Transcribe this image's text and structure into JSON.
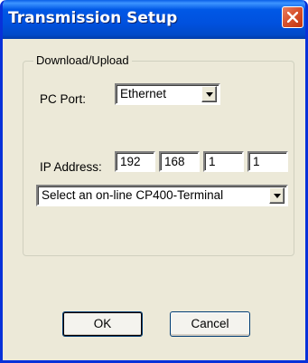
{
  "window": {
    "title": "Transmission Setup",
    "close_icon": "close-icon"
  },
  "group": {
    "legend": "Download/Upload"
  },
  "pc_port": {
    "label": "PC Port:",
    "value": "Ethernet"
  },
  "ip_address": {
    "label": "IP Address:",
    "octets": [
      "192",
      "168",
      "1",
      "1"
    ]
  },
  "terminal_select": {
    "value": "Select an on-line CP400-Terminal"
  },
  "buttons": {
    "ok": "OK",
    "cancel": "Cancel"
  },
  "colors": {
    "titlebar": "#0058e6",
    "close_button": "#d8532f",
    "dialog_background": "#ece9d8"
  }
}
